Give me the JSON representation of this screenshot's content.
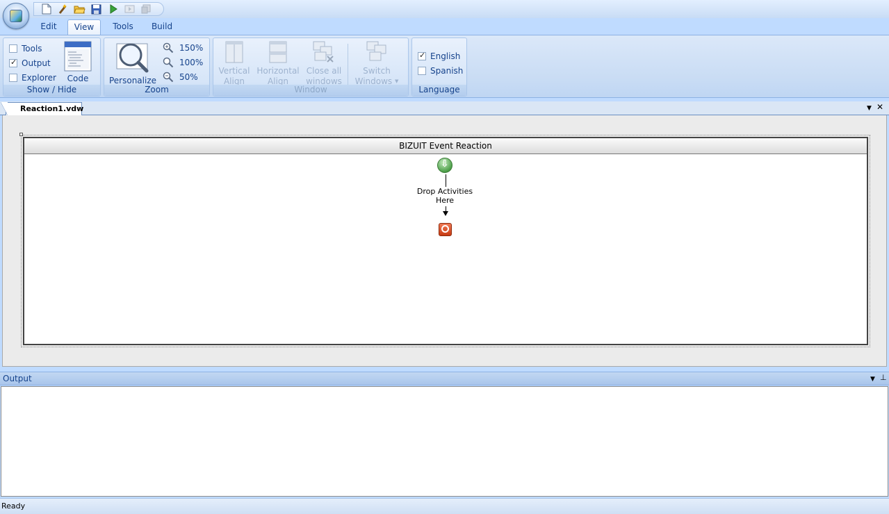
{
  "ribbon": {
    "tabs": [
      {
        "label": "Edit",
        "active": false
      },
      {
        "label": "View",
        "active": true
      },
      {
        "label": "Tools",
        "active": false
      },
      {
        "label": "Build",
        "active": false
      }
    ],
    "show_hide": {
      "label": "Show / Hide",
      "tools": {
        "label": "Tools",
        "checked": false
      },
      "output": {
        "label": "Output",
        "checked": true
      },
      "explorer": {
        "label": "Explorer",
        "checked": false
      },
      "code": "Code"
    },
    "zoom": {
      "label": "Zoom",
      "personalize": "Personalize",
      "z150": "150%",
      "z100": "100%",
      "z50": "50%"
    },
    "window": {
      "label": "Window",
      "vertical_align": {
        "line1": "Vertical",
        "line2": "Align"
      },
      "horizontal_align": {
        "line1": "Horizontal",
        "line2": "Align"
      },
      "close_all": {
        "line1": "Close all",
        "line2": "windows"
      },
      "switch_windows": {
        "line1": "Switch",
        "line2": "Windows"
      }
    },
    "language": {
      "label": "Language",
      "english": {
        "label": "English",
        "checked": true
      },
      "spanish": {
        "label": "Spanish",
        "checked": false
      }
    }
  },
  "document": {
    "tab_label": "Reaction1.vdw",
    "activity_title": "BIZUIT Event Reaction",
    "drop_line1": "Drop Activities",
    "drop_line2": "Here"
  },
  "output": {
    "title": "Output"
  },
  "status": {
    "text": "Ready"
  }
}
